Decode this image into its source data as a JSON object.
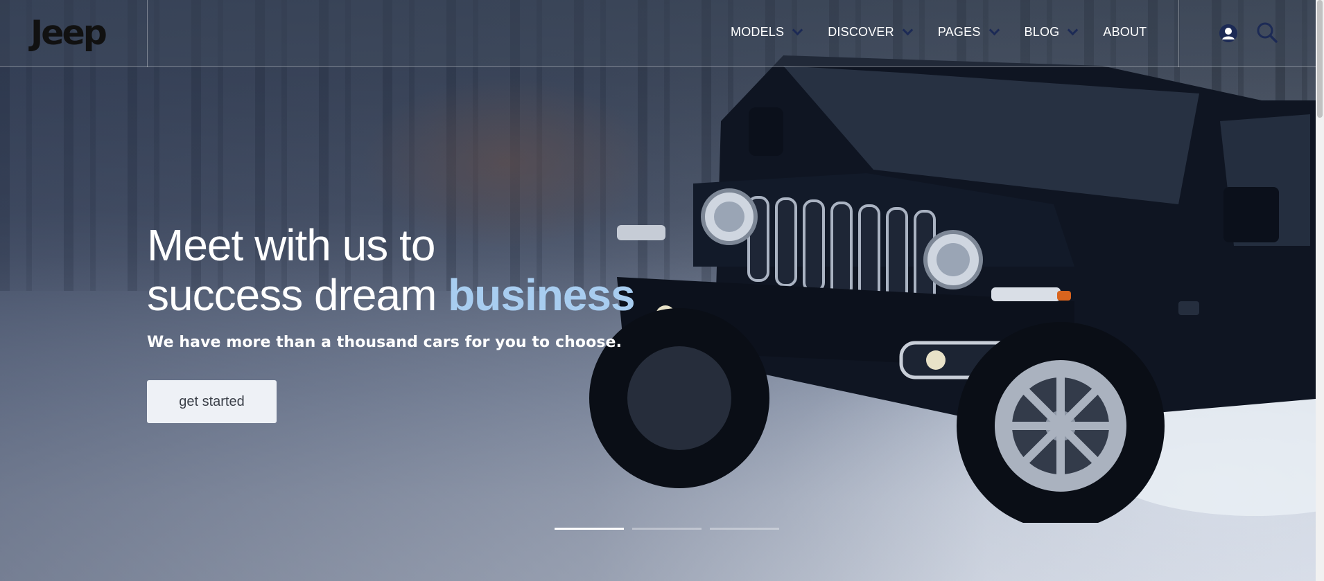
{
  "brand": {
    "logo_text": "Jeep"
  },
  "nav": {
    "items": [
      {
        "label": "MODELS",
        "has_dropdown": true
      },
      {
        "label": "DISCOVER",
        "has_dropdown": true
      },
      {
        "label": "PAGES",
        "has_dropdown": true
      },
      {
        "label": "BLOG",
        "has_dropdown": true
      },
      {
        "label": "ABOUT",
        "has_dropdown": false
      }
    ],
    "icons": [
      "user-icon",
      "search-icon"
    ]
  },
  "hero": {
    "headline_line1": "Meet with us to",
    "headline_line2": "success dream ",
    "headline_accent": "business",
    "subline": "We have more than a thousand cars for you to choose.",
    "cta_label": "get started",
    "slides_total": 3,
    "active_slide": 1
  },
  "colors": {
    "accent": "#a8cdf0",
    "nav_chevron": "#1c2a55",
    "button_bg": "#eef1f6",
    "jeep_body": "#0f1522"
  }
}
